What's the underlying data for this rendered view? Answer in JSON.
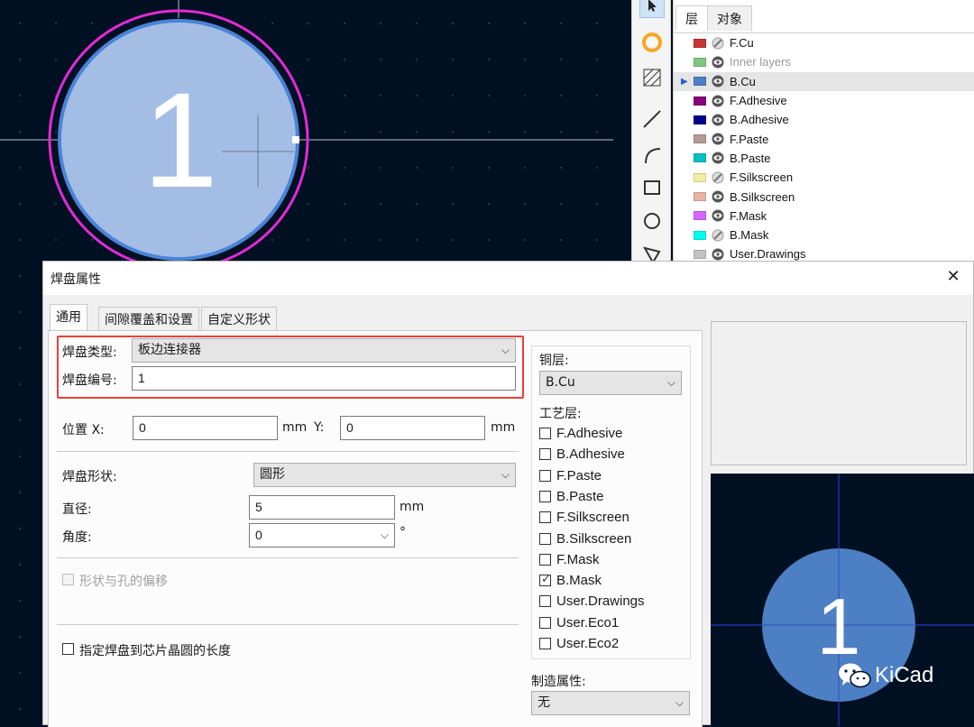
{
  "canvas": {
    "pad_number": "1"
  },
  "toolbar": {
    "tools": [
      "select-arrow-icon",
      "pad-icon",
      "hatch-zone-icon",
      "line-icon",
      "arc-icon",
      "rectangle-icon",
      "circle-icon",
      "polygon-icon"
    ]
  },
  "layers_panel": {
    "tabs": [
      "层",
      "对象"
    ],
    "active_tab": "层",
    "selected_layer": "B.Cu",
    "items": [
      {
        "name": "F.Cu",
        "color": "#c83434",
        "visibility": "hidden"
      },
      {
        "name": "Inner layers",
        "color": "#7fc67f",
        "visibility": "visible",
        "dim": true
      },
      {
        "name": "B.Cu",
        "color": "#4d7fc4",
        "visibility": "visible"
      },
      {
        "name": "F.Adhesive",
        "color": "#84007b",
        "visibility": "visible"
      },
      {
        "name": "B.Adhesive",
        "color": "#00008a",
        "visibility": "visible"
      },
      {
        "name": "F.Paste",
        "color": "#b49b96",
        "visibility": "visible"
      },
      {
        "name": "B.Paste",
        "color": "#00c2c2",
        "visibility": "visible"
      },
      {
        "name": "F.Silkscreen",
        "color": "#f2eda1",
        "visibility": "hidden"
      },
      {
        "name": "B.Silkscreen",
        "color": "#e8b2a7",
        "visibility": "visible"
      },
      {
        "name": "F.Mask",
        "color": "#d864ff",
        "visibility": "visible"
      },
      {
        "name": "B.Mask",
        "color": "#02ffee",
        "visibility": "hidden"
      },
      {
        "name": "User.Drawings",
        "color": "#c2c2c2",
        "visibility": "visible"
      }
    ]
  },
  "dialog": {
    "title": "焊盘属性",
    "close_glyph": "✕",
    "tabs": [
      "通用",
      "间隙覆盖和设置",
      "自定义形状"
    ],
    "active_tab": "通用",
    "pad_type": {
      "label": "焊盘类型:",
      "value": "板边连接器"
    },
    "pad_number": {
      "label": "焊盘编号:",
      "value": "1"
    },
    "position": {
      "x_label": "位置 X:",
      "x_value": "0",
      "x_unit": "mm",
      "y_label": "Y:",
      "y_value": "0",
      "y_unit": "mm"
    },
    "shape": {
      "label": "焊盘形状:",
      "value": "圆形"
    },
    "diameter": {
      "label": "直径:",
      "value": "5",
      "unit": "mm"
    },
    "angle": {
      "label": "角度:",
      "value": "0",
      "unit": "°"
    },
    "offset_checkbox": {
      "label": "形状与孔的偏移",
      "checked": false,
      "disabled": true
    },
    "die_length_checkbox": {
      "label": "指定焊盘到芯片晶圆的长度",
      "checked": false
    },
    "copper": {
      "label": "铜层:",
      "value": "B.Cu"
    },
    "technical": {
      "label": "工艺层:",
      "items": [
        {
          "name": "F.Adhesive",
          "checked": false
        },
        {
          "name": "B.Adhesive",
          "checked": false
        },
        {
          "name": "F.Paste",
          "checked": false
        },
        {
          "name": "B.Paste",
          "checked": false
        },
        {
          "name": "F.Silkscreen",
          "checked": false
        },
        {
          "name": "B.Silkscreen",
          "checked": false
        },
        {
          "name": "F.Mask",
          "checked": false
        },
        {
          "name": "B.Mask",
          "checked": true
        },
        {
          "name": "User.Drawings",
          "checked": false
        },
        {
          "name": "User.Eco1",
          "checked": false
        },
        {
          "name": "User.Eco2",
          "checked": false
        }
      ]
    },
    "fabrication": {
      "label": "制造属性:",
      "value": "无"
    },
    "preview": {
      "pad_number": "1"
    },
    "watermark": "KiCad"
  }
}
